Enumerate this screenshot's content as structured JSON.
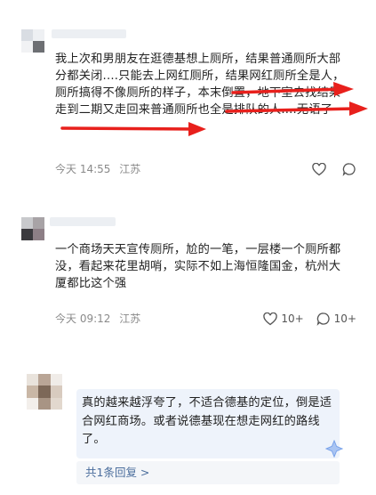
{
  "comments": [
    {
      "text": "我上次和男朋友在逛德基想上厕所，结果普通厕所大部分都关闭....只能去上网红厕所，结果网红厕所全是人，厕所搞得不像厕所的样子，本末倒置，地下室去找结果走到二期又走回来普通厕所也全是排队的人....无语了",
      "time": "今天 14:55",
      "location": "江苏",
      "likes": "",
      "icons": {
        "like": "heart-icon",
        "comment": "comment-icon"
      }
    },
    {
      "text": "一个商场天天宣传厕所，尬的一笔，一层楼一个厕所都没，看起来花里胡哨，实际不如上海恒隆国金，杭州大厦都比这个强",
      "time": "今天 09:12",
      "location": "江苏",
      "likes": "10+",
      "comment_count": "10+",
      "icons": {
        "like": "heart-icon",
        "comment": "comment-icon"
      }
    },
    {
      "text": "真的越来越浮夸了，不适合德基的定位，倒是适合网红商场。或者说德基现在想走网红的路线了。",
      "replies_label": "共1条回复 >",
      "icons": {
        "badge": "sparkle-icon"
      }
    }
  ],
  "colors": {
    "arrow": "#e8201c",
    "meta_text": "#8a8a8a",
    "link": "#4a6d9c",
    "highlight_bg": "#eef3fb"
  }
}
